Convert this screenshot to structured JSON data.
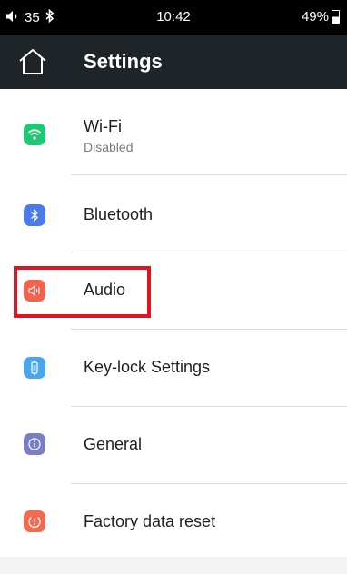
{
  "status_bar": {
    "volume_level": "35",
    "time": "10:42",
    "battery": "49%",
    "battery_level_fraction": 0.49
  },
  "app_bar": {
    "title": "Settings",
    "home_icon": "home-icon"
  },
  "settings_items": [
    {
      "label": "Wi-Fi",
      "sublabel": "Disabled",
      "icon": "wifi-icon",
      "icon_color": "#1ec773"
    },
    {
      "label": "Bluetooth",
      "icon": "bluetooth-icon",
      "icon_color": "#4a7bea"
    },
    {
      "label": "Audio",
      "icon": "speaker-icon",
      "icon_color": "#f0634e",
      "highlighted": true
    },
    {
      "label": "Key-lock Settings",
      "icon": "key-lock-icon",
      "icon_color": "#4aa6ec"
    },
    {
      "label": "General",
      "icon": "info-icon",
      "icon_color": "#7a7fc4"
    },
    {
      "label": "Factory data reset",
      "icon": "reset-icon",
      "icon_color": "#f36a4e"
    }
  ],
  "colors": {
    "status_bar_bg": "#000000",
    "app_bar_bg": "#1e2428",
    "highlight_border": "#e0141e",
    "divider": "#dddddd"
  }
}
